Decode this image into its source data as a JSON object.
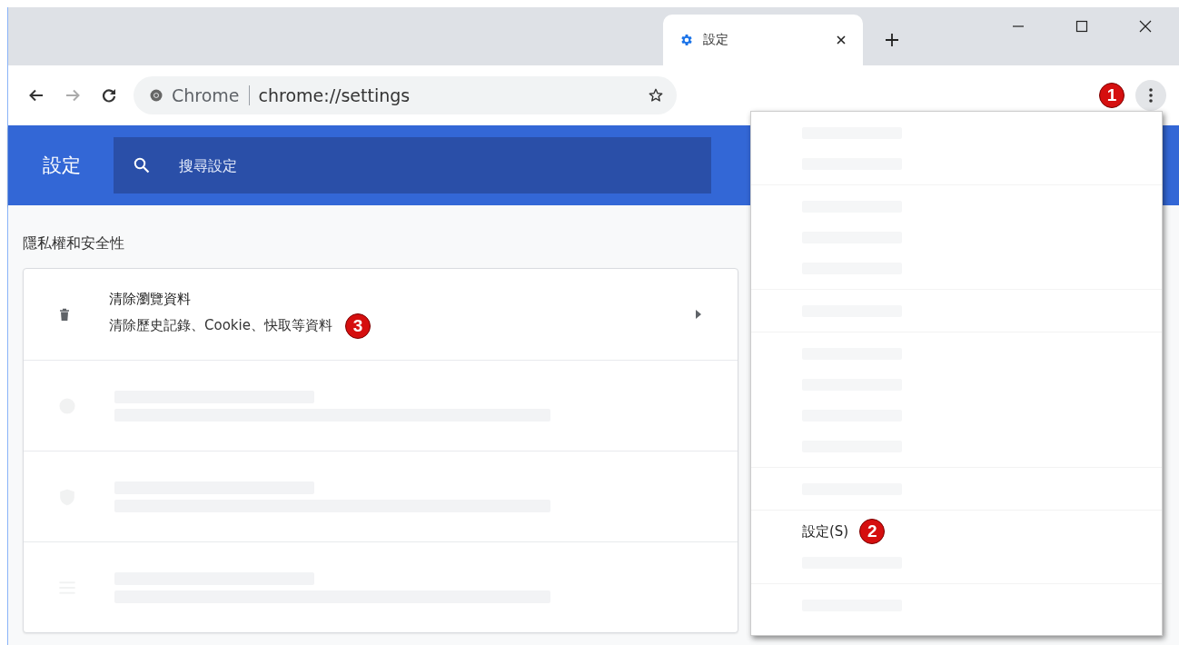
{
  "tab": {
    "title": "設定",
    "selected": true
  },
  "toolbar": {
    "omnibox_chip": "Chrome",
    "url": "chrome://settings",
    "menu_badge": "1"
  },
  "header": {
    "title": "設定",
    "search": {
      "placeholder": "搜尋設定"
    }
  },
  "section": {
    "title": "隱私權和安全性"
  },
  "rows": [
    {
      "kind": "item",
      "title": "清除瀏覽資料",
      "subtitle": "清除歷史記錄、Cookie、快取等資料",
      "badge": "3"
    },
    {
      "kind": "faded"
    },
    {
      "kind": "faded"
    },
    {
      "kind": "faded"
    }
  ],
  "menu": [
    {
      "kind": "faded"
    },
    {
      "kind": "faded"
    },
    {
      "kind": "separator"
    },
    {
      "kind": "faded"
    },
    {
      "kind": "faded"
    },
    {
      "kind": "faded"
    },
    {
      "kind": "separator"
    },
    {
      "kind": "faded"
    },
    {
      "kind": "separator"
    },
    {
      "kind": "faded"
    },
    {
      "kind": "faded"
    },
    {
      "kind": "faded"
    },
    {
      "kind": "faded"
    },
    {
      "kind": "separator"
    },
    {
      "kind": "faded"
    },
    {
      "kind": "separator"
    },
    {
      "kind": "item",
      "label": "設定(S)",
      "badge": "2"
    },
    {
      "kind": "faded"
    },
    {
      "kind": "separator"
    },
    {
      "kind": "faded"
    }
  ]
}
